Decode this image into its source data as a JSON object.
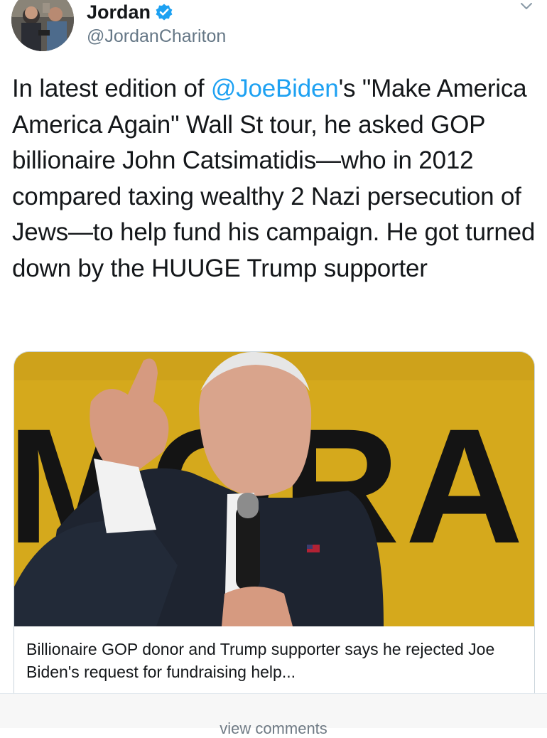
{
  "tweet": {
    "author": {
      "display_name": "Jordan",
      "handle": "@JordanChariton",
      "verified": true
    },
    "text_segments": [
      {
        "type": "text",
        "value": "In latest edition of "
      },
      {
        "type": "mention",
        "value": "@JoeBiden"
      },
      {
        "type": "text",
        "value": "'s \"Make America America Again\" Wall St tour, he asked GOP billionaire John Catsimatidis—who in 2012 compared taxing wealthy 2 Nazi persecution of Jews—to help fund his campaign. He got turned down by the HUUGE Trump supporter"
      }
    ],
    "card": {
      "image_icon": "speaker-photo",
      "banner_text": "MORAL",
      "title": "Billionaire GOP donor and Trump supporter says he rejected Joe Biden's request for fundraising help..."
    }
  },
  "footer": {
    "view_comments_label": "view comments"
  },
  "colors": {
    "mention": "#1da1f2",
    "verified": "#1da1f2",
    "text": "#14171a",
    "secondary": "#657786",
    "card_border": "#ccd6dd",
    "banner_yellow": "#d9ae1e"
  }
}
